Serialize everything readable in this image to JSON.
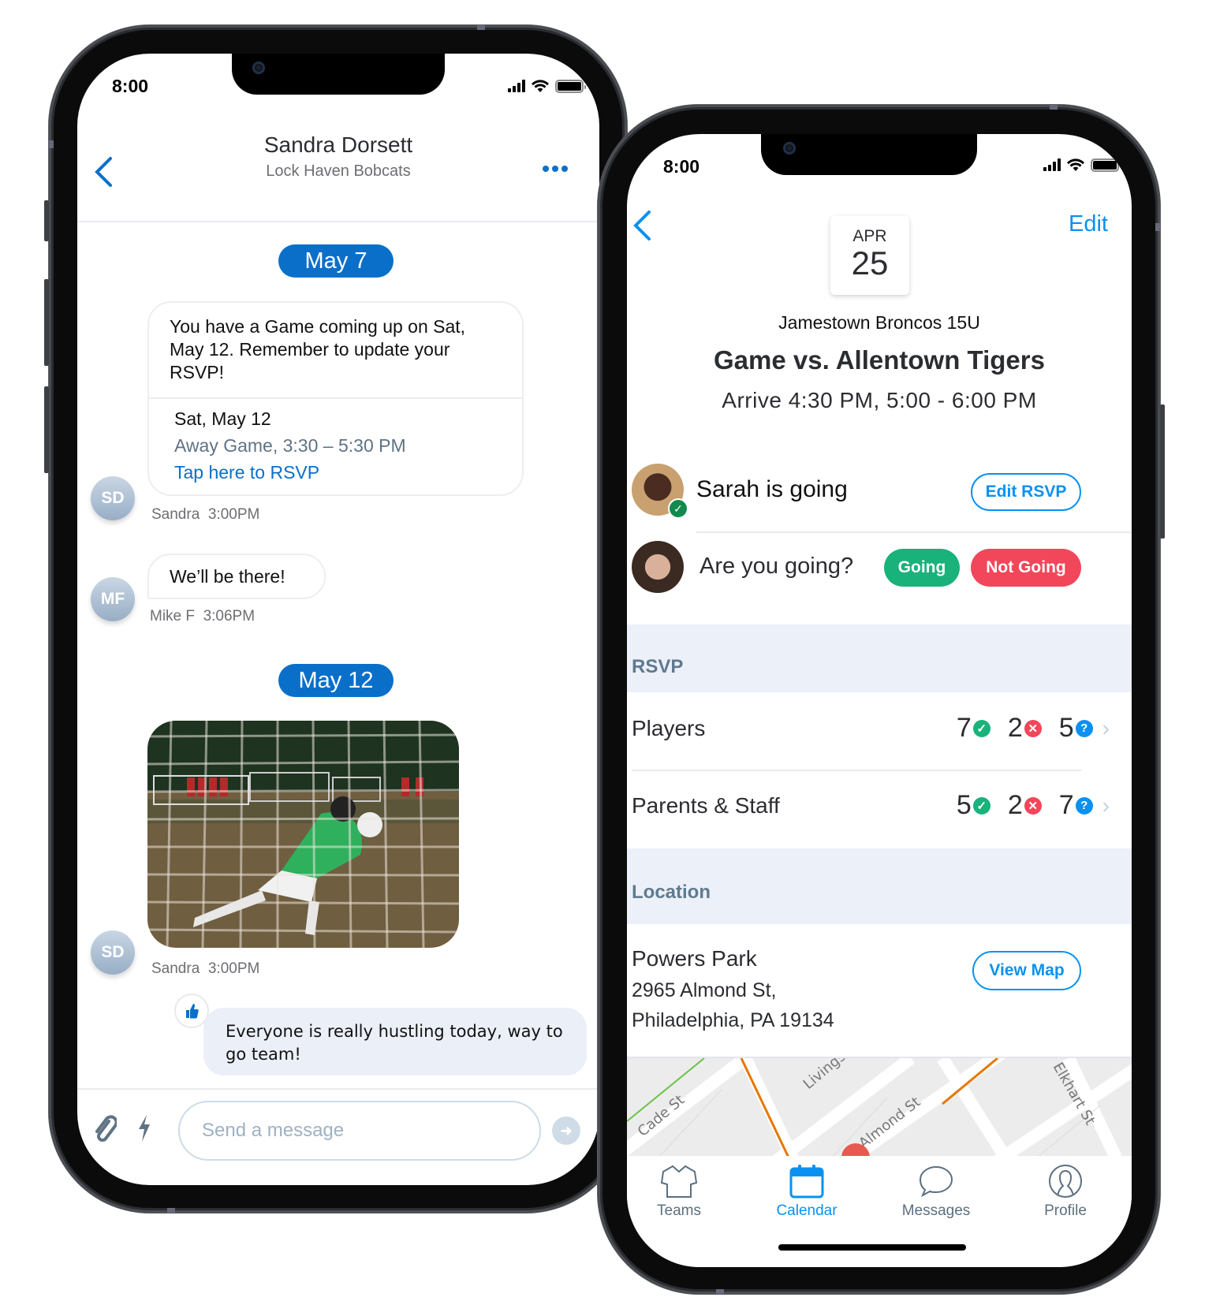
{
  "left_phone": {
    "status": {
      "time": "8:00"
    },
    "header": {
      "title": "Sandra Dorsett",
      "subtitle": "Lock Haven Bobcats",
      "back_icon": "chevron-left-icon",
      "more_icon": "more-dots-icon"
    },
    "messages": [
      {
        "type": "date",
        "label": "May 7"
      },
      {
        "type": "event",
        "text": "You have a Game coming up on Sat, May 12. Remember to update your RSVP!",
        "event_date": "Sat, May 12",
        "event_detail": "Away Game, 3:30 – 5:30 PM",
        "rsvp_link": "Tap here to RSVP",
        "avatar_initials": "SD",
        "sender": "Sandra",
        "time": "3:00PM"
      },
      {
        "type": "text",
        "text": "We’ll be there!",
        "avatar_initials": "MF",
        "sender": "Mike F",
        "time": "3:06PM"
      },
      {
        "type": "date",
        "label": "May 12"
      },
      {
        "type": "image",
        "alt": "goalkeeper diving for soccer ball",
        "avatar_initials": "SD",
        "sender": "Sandra",
        "time": "3:00PM"
      },
      {
        "type": "text-self",
        "text": "Everyone is really hustling today, way to go team!",
        "reaction_icon": "thumbs-up-icon"
      }
    ],
    "composer": {
      "placeholder": "Send a message",
      "attach_icon": "paperclip-icon",
      "quick_icon": "lightning-icon",
      "send_icon": "send-arrow-icon"
    }
  },
  "right_phone": {
    "status": {
      "time": "8:00"
    },
    "nav": {
      "edit_label": "Edit",
      "back_icon": "chevron-left-icon"
    },
    "event": {
      "month": "APR",
      "day": "25",
      "team": "Jamestown Broncos 15U",
      "title": "Game vs. Allentown Tigers",
      "time": "Arrive 4:30 PM, 5:00 - 6:00 PM"
    },
    "rsvp_self": [
      {
        "text": "Sarah is going",
        "button": "Edit RSVP"
      },
      {
        "text": "Are you going?",
        "going_label": "Going",
        "not_going_label": "Not Going"
      }
    ],
    "rsvp_section": {
      "header": "RSVP",
      "rows": [
        {
          "label": "Players",
          "going": "7",
          "not_going": "2",
          "unknown": "5"
        },
        {
          "label": "Parents & Staff",
          "going": "5",
          "not_going": "2",
          "unknown": "7"
        }
      ]
    },
    "location_section": {
      "header": "Location",
      "name": "Powers Park",
      "address_line1": "2965 Almond St,",
      "address_line2": "Philadelphia, PA 19134",
      "button": "View Map",
      "map_labels": [
        "Livingston St",
        "Almond St",
        "Elkhart St",
        "Cade St"
      ]
    },
    "tabs": [
      {
        "label": "Teams",
        "icon": "jersey-icon",
        "active": false
      },
      {
        "label": "Calendar",
        "icon": "calendar-icon",
        "active": true
      },
      {
        "label": "Messages",
        "icon": "chat-bubble-icon",
        "active": false
      },
      {
        "label": "Profile",
        "icon": "person-icon",
        "active": false
      }
    ],
    "colors": {
      "accent": "#0a91f0",
      "going": "#19b27b",
      "not_going": "#f2465a",
      "unknown": "#0a91f0"
    }
  }
}
